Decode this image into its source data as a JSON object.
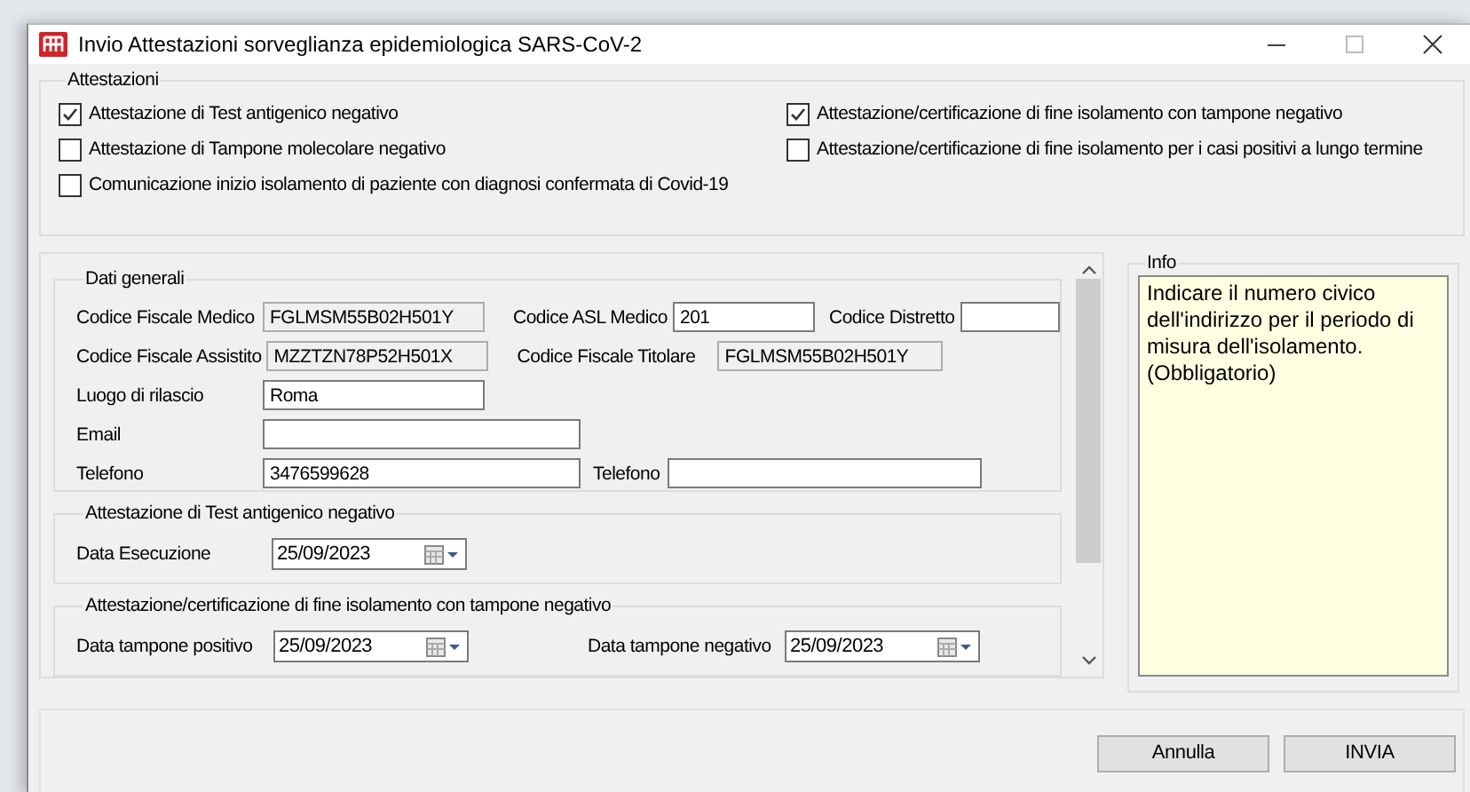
{
  "window": {
    "title": "Invio Attestazioni sorveglianza epidemiologica SARS-CoV-2"
  },
  "attestazioni": {
    "title": "Attestazioni",
    "options_left": [
      {
        "label": "Attestazione di Test antigenico negativo",
        "checked": true
      },
      {
        "label": "Attestazione di Tampone molecolare negativo",
        "checked": false
      },
      {
        "label": "Comunicazione inizio isolamento di paziente con diagnosi confermata di Covid-19",
        "checked": false
      }
    ],
    "options_right": [
      {
        "label": "Attestazione/certificazione di fine isolamento con tampone negativo",
        "checked": true
      },
      {
        "label": "Attestazione/certificazione di fine isolamento per i casi positivi a lungo termine",
        "checked": false
      }
    ]
  },
  "dati_generali": {
    "title": "Dati generali",
    "rows": [
      [
        {
          "label": "Codice Fiscale Medico",
          "value": "FGLMSM55B02H501Y",
          "readonly": true
        },
        {
          "label": "Codice ASL Medico",
          "value": "201",
          "readonly": false
        },
        {
          "label": "Codice Distretto",
          "readonly": false
        }
      ],
      [
        {
          "label": "Codice Fiscale Assistito",
          "value": "MZZTZN78P52H501X",
          "readonly": true
        },
        {
          "label": "Codice Fiscale Titolare",
          "value": "FGLMSM55B02H501Y",
          "readonly": true
        }
      ],
      [
        {
          "label": "Luogo di rilascio",
          "value": "Roma",
          "readonly": false
        }
      ],
      [
        {
          "label": "Email",
          "readonly": false
        }
      ],
      [
        {
          "label": "Telefono",
          "value": "3476599628",
          "readonly": false
        },
        {
          "label": "Telefono",
          "readonly": false
        }
      ]
    ]
  },
  "test_antigenico": {
    "title": "Attestazione di Test antigenico negativo",
    "fields": [
      {
        "label": "Data Esecuzione",
        "value": "25/09/2023"
      }
    ]
  },
  "fine_isolamento": {
    "title": "Attestazione/certificazione di fine isolamento con tampone negativo",
    "fields": [
      {
        "label": "Data tampone positivo",
        "value": "25/09/2023"
      },
      {
        "label": "Data tampone negativo",
        "value": "25/09/2023"
      }
    ]
  },
  "info": {
    "title": "Info",
    "text": "Indicare il numero civico dell'indirizzo per il periodo di misura dell'isolamento. (Obbligatorio)"
  },
  "buttons": [
    "Annulla",
    "INVIA"
  ]
}
